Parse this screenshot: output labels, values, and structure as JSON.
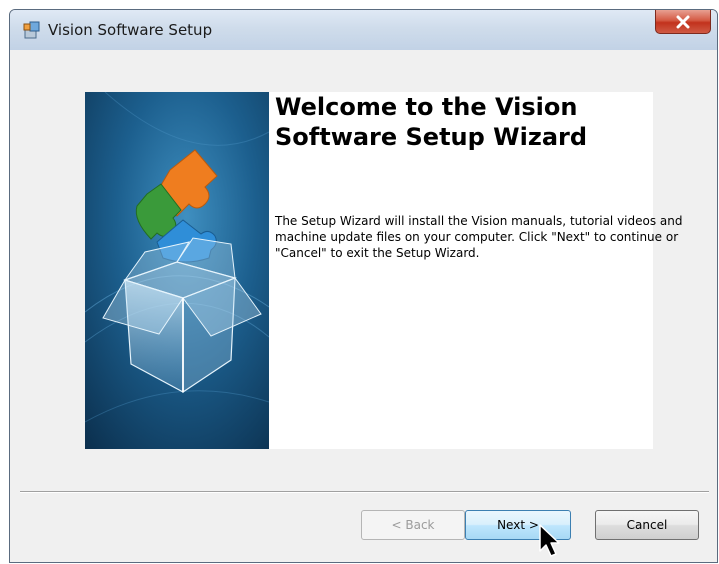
{
  "window": {
    "title": "Vision Software Setup"
  },
  "wizard": {
    "title": "Welcome to the Vision\nSoftware Setup Wizard",
    "description": "The Setup Wizard will install the Vision manuals, tutorial videos and machine update files on your computer.  Click \"Next\" to continue or \"Cancel\" to exit the Setup Wizard."
  },
  "buttons": {
    "back": "< Back",
    "next": "Next >",
    "cancel": "Cancel"
  },
  "icons": {
    "app": "setup-installer-icon",
    "close": "close-icon",
    "banner": "puzzle-box-illustration",
    "cursor": "mouse-pointer-icon"
  },
  "colors": {
    "close_button": "#c2321d",
    "next_button_border": "#3c7fb1",
    "banner_dark": "#0d3a5c",
    "puzzle_orange": "#ef7d1f",
    "puzzle_green": "#3a9a3a",
    "puzzle_blue": "#2f8ed8"
  }
}
